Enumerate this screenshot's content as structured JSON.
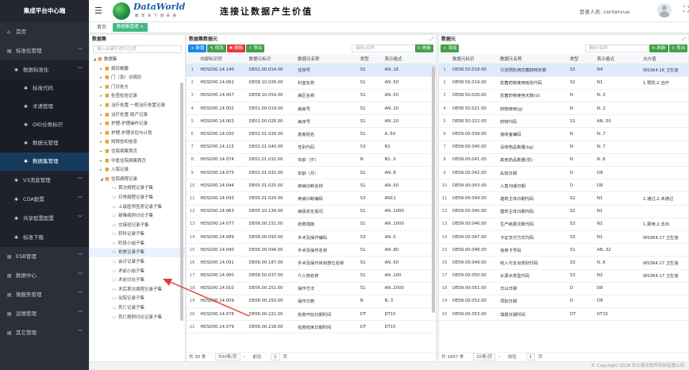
{
  "app": {
    "title": "集成平台中心端"
  },
  "sidebar": [
    {
      "label": "首页",
      "icon": "home-icon",
      "level": 0,
      "arrow": ""
    },
    {
      "label": "标准化管理",
      "icon": "list-icon",
      "level": 0,
      "arrow": "﹀"
    },
    {
      "label": "数据标准化",
      "icon": "gear-icon",
      "level": 1,
      "arrow": "﹀"
    },
    {
      "label": "标准代码",
      "icon": "gear-icon",
      "level": 2,
      "arrow": ""
    },
    {
      "label": "术语管理",
      "icon": "gear-icon",
      "level": 2,
      "arrow": ""
    },
    {
      "label": "OID分类标识",
      "icon": "gear-icon",
      "level": 2,
      "arrow": ""
    },
    {
      "label": "数据元管理",
      "icon": "gear-icon",
      "level": 2,
      "arrow": ""
    },
    {
      "label": "数据集管理",
      "icon": "gear-icon",
      "level": 2,
      "arrow": "",
      "active": true
    },
    {
      "label": "V3消息管理",
      "icon": "gear-icon",
      "level": 1,
      "arrow": "﹀"
    },
    {
      "label": "CDA配置",
      "icon": "gear-icon",
      "level": 1,
      "arrow": "﹀"
    },
    {
      "label": "共享配置配置",
      "icon": "gear-icon",
      "level": 1,
      "arrow": "﹀"
    },
    {
      "label": "标准下载",
      "icon": "gear-icon",
      "level": 1,
      "arrow": ""
    },
    {
      "label": "ESB管理",
      "icon": "list-icon",
      "level": 0,
      "arrow": "﹀"
    },
    {
      "label": "数据中心",
      "icon": "list-icon",
      "level": 0,
      "arrow": "﹀"
    },
    {
      "label": "微服务管理",
      "icon": "list-icon",
      "level": 0,
      "arrow": "﹀"
    },
    {
      "label": "运维管理",
      "icon": "list-icon",
      "level": 0,
      "arrow": "﹀"
    },
    {
      "label": "其它管理",
      "icon": "list-icon",
      "level": 0,
      "arrow": "﹀"
    }
  ],
  "header": {
    "logo_text": "DataWorld",
    "logo_sub": "数 享 天 下 创 未 来",
    "slogan": "连接让数据产生价值",
    "user_label": "登录人员: centervue"
  },
  "tabs": {
    "home": "首页",
    "active": "数据集管理 ×"
  },
  "tree": {
    "title": "数据集",
    "search_placeholder": "输入关键字进行过滤",
    "items": [
      {
        "label": "数据集",
        "depth": 0,
        "type": "folder",
        "tw": "◢"
      },
      {
        "label": "病历概要",
        "depth": 1,
        "type": "folder",
        "tw": "▸"
      },
      {
        "label": "门（急）诊病历",
        "depth": 1,
        "type": "folder",
        "tw": "▸"
      },
      {
        "label": "门诊处方",
        "depth": 1,
        "type": "folder",
        "tw": "▸"
      },
      {
        "label": "检查检验记录",
        "depth": 1,
        "type": "folder",
        "tw": "▸"
      },
      {
        "label": "治疗处置-一般治疗处置记录",
        "depth": 1,
        "type": "folder",
        "tw": "▸"
      },
      {
        "label": "治疗处置-助产记录",
        "depth": 1,
        "type": "folder",
        "tw": "▸"
      },
      {
        "label": "护理-护理操作记录",
        "depth": 1,
        "type": "folder",
        "tw": "▸"
      },
      {
        "label": "护理-护理评估与计划",
        "depth": 1,
        "type": "folder",
        "tw": "▸"
      },
      {
        "label": "知情告知信息",
        "depth": 1,
        "type": "folder",
        "tw": "▸"
      },
      {
        "label": "住院病案首页",
        "depth": 1,
        "type": "folder",
        "tw": "▸"
      },
      {
        "label": "中医住院病案首页",
        "depth": 1,
        "type": "folder",
        "tw": "▸"
      },
      {
        "label": "入院记录",
        "depth": 1,
        "type": "folder",
        "tw": "▸"
      },
      {
        "label": "住院病程记录",
        "depth": 1,
        "type": "folder",
        "tw": "◢"
      },
      {
        "label": "首次病程记录子集",
        "depth": 2,
        "type": "doc",
        "tw": ""
      },
      {
        "label": "日常病程记录子集",
        "depth": 2,
        "type": "doc",
        "tw": ""
      },
      {
        "label": "上级医师查房记录子集",
        "depth": 2,
        "type": "doc",
        "tw": ""
      },
      {
        "label": "疑难病例讨论子集",
        "depth": 2,
        "type": "doc",
        "tw": ""
      },
      {
        "label": "交接班记录子集",
        "depth": 2,
        "type": "doc",
        "tw": ""
      },
      {
        "label": "转科记录子集",
        "depth": 2,
        "type": "doc",
        "tw": ""
      },
      {
        "label": "阶段小结子集",
        "depth": 2,
        "type": "doc",
        "tw": ""
      },
      {
        "label": "抢救记录子集",
        "depth": 2,
        "type": "doc",
        "tw": "",
        "highlight": true
      },
      {
        "label": "会诊记录子集",
        "depth": 2,
        "type": "doc",
        "tw": ""
      },
      {
        "label": "术前小结子集",
        "depth": 2,
        "type": "doc",
        "tw": ""
      },
      {
        "label": "术前讨论子集",
        "depth": 2,
        "type": "doc",
        "tw": ""
      },
      {
        "label": "术后首次病程记录子集",
        "depth": 2,
        "type": "doc",
        "tw": ""
      },
      {
        "label": "出院记录子集",
        "depth": 2,
        "type": "doc",
        "tw": ""
      },
      {
        "label": "死亡记录子集",
        "depth": 2,
        "type": "doc",
        "tw": ""
      },
      {
        "label": "死亡病例讨论记录子集",
        "depth": 2,
        "type": "doc",
        "tw": ""
      }
    ]
  },
  "dataset_panel": {
    "title": "数据集数据元",
    "buttons": [
      {
        "label": "+ 新增",
        "color": "#1e88e5"
      },
      {
        "label": "✎ 修改",
        "color": "#43a047"
      },
      {
        "label": "✖ 删除",
        "color": "#e53935"
      },
      {
        "label": "⇩ 导出",
        "color": "#43a047"
      }
    ],
    "search_placeholder": "编码/名称",
    "refresh": "↻ 刷新",
    "columns": [
      "",
      "内部标识符",
      "数据元标识",
      "数据元名称",
      "类型",
      "表示格式"
    ],
    "rows": [
      [
        "1",
        "HDSD00.14.140",
        "DE01.00.014.00",
        "住院号",
        "S1",
        "AN..18"
      ],
      [
        "2",
        "HDSD00.14.062",
        "DE08.10.026.00",
        "科室名称",
        "S1",
        "AN..50"
      ],
      [
        "3",
        "HDSD00.14.007",
        "DE08.10.054.00",
        "病区名称",
        "S1",
        "AN..50"
      ],
      [
        "4",
        "HDSD00.14.002",
        "DE01.00.019.00",
        "病房号",
        "S1",
        "AN..10"
      ],
      [
        "5",
        "HDSD00.14.003",
        "DE01.00.026.00",
        "病床号",
        "S1",
        "AN..10"
      ],
      [
        "6",
        "HDSD00.14.030",
        "DE02.01.039.00",
        "患者姓名",
        "S1",
        "A..50"
      ],
      [
        "7",
        "HDSD00.14.115",
        "DE02.01.040.00",
        "性别代码",
        "S3",
        "N1"
      ],
      [
        "8",
        "HDSD00.14.074",
        "DE02.01.032.00",
        "年龄（岁）",
        "N",
        "N1..3"
      ],
      [
        "9",
        "HDSD00.14.075",
        "DE02.01.032.00",
        "年龄（月）",
        "S1",
        "AN..8"
      ],
      [
        "10",
        "HDSD00.14.044",
        "DE05.01.025.00",
        "疾病诊断名称",
        "S1",
        "AN..50"
      ],
      [
        "11",
        "HDSD00.14.043",
        "DE05.01.024.00",
        "疾病诊断编码",
        "S3",
        "AN11"
      ],
      [
        "12",
        "HDSD00.14.063",
        "DE05.10.134.00",
        "病情变化情况",
        "S1",
        "AN..1000"
      ],
      [
        "13",
        "HDSD00.14.077",
        "DE06.00.231.00",
        "抢救措施",
        "S1",
        "AN..1000"
      ],
      [
        "14",
        "HDSD00.14.089",
        "DE06.00.093.00",
        "手术及操作编码",
        "S3",
        "AN..5"
      ],
      [
        "15",
        "HDSD00.14.090",
        "DE06.00.094.00",
        "手术及操作名称",
        "S1",
        "AN..80"
      ],
      [
        "16",
        "HDSD00.14.091",
        "DE06.00.187.00",
        "手术及操作目标部位名称",
        "S1",
        "AN..50"
      ],
      [
        "17",
        "HDSD00.14.060",
        "DE08.50.037.00",
        "介入物名称",
        "S1",
        "AN..100"
      ],
      [
        "18",
        "HDSD00.14.010",
        "DE06.00.251.00",
        "操作方法",
        "S1",
        "AN..2000"
      ],
      [
        "19",
        "HDSD00.14.009",
        "DE06.00.250.00",
        "操作次数",
        "N",
        "N..3"
      ],
      [
        "20",
        "HDSD00.14.078",
        "DE06.00.221.00",
        "抢救开始日期时间",
        "DT",
        "DT15"
      ],
      [
        "21",
        "HDSD00.14.079",
        "DE06.00.218.00",
        "抢救结束日期时间",
        "DT",
        "DT15"
      ]
    ],
    "pager": {
      "total": "共 30 条",
      "size": "500条/页",
      "prev": "‹",
      "page_label": "前往",
      "page": "1",
      "suffix": "页"
    }
  },
  "element_panel": {
    "title": "数据元",
    "buttons": [
      {
        "label": "+ 添加",
        "color": "#43a047"
      }
    ],
    "search_placeholder": "编码/名称",
    "actions": [
      {
        "label": "↻ 刷新",
        "color": "#43a047"
      },
      {
        "label": "⇩ 导出",
        "color": "#43a047"
      }
    ],
    "columns": [
      "",
      "数据元标识",
      "数据元名称",
      "类型",
      "表示格式",
      "允许值"
    ],
    "rows": [
      [
        "1",
        "DE08.50.018.00",
        "引流预防用抗菌药物天数",
        "S3",
        "N4",
        "WS364.16 卫生信"
      ],
      [
        "2",
        "DE08.50.019.00",
        "抗菌药物使用级别代码",
        "S2",
        "N1",
        "1.预防;2.治疗"
      ],
      [
        "3",
        "DE08.50.020.00",
        "抗菌药物使用天数(U)",
        "N",
        "N..3",
        ""
      ],
      [
        "4",
        "DE08.50.021.00",
        "药物使用(g)",
        "N",
        "N..2",
        ""
      ],
      [
        "5",
        "DE08.50.022.00",
        "药物代码",
        "S1",
        "AN..50",
        ""
      ],
      [
        "6",
        "DE09.00.039.00",
        "接收者编码",
        "N",
        "N..7",
        ""
      ],
      [
        "7",
        "DE09.00.040.00",
        "设收物品数量(kg)",
        "N",
        "N..7",
        ""
      ],
      [
        "8",
        "DE09.00.041.00",
        "其他药品数量(张)",
        "N",
        "N..6",
        ""
      ],
      [
        "9",
        "DE09.00.042.00",
        "失效日期",
        "D",
        "D8",
        ""
      ],
      [
        "10",
        "DE09.00.043.00",
        "入患沟通日期",
        "D",
        "D8",
        ""
      ],
      [
        "11",
        "DE09.00.044.00",
        "建筑主体日期代码",
        "S2",
        "N1",
        "1.通过;2.未通过"
      ],
      [
        "12",
        "DE09.00.045.00",
        "建筑主体日期代码",
        "S2",
        "N1",
        ""
      ],
      [
        "13",
        "DE09.00.046.00",
        "生产耗费次数代码",
        "S3",
        "N1",
        "1.费用;2.支出"
      ],
      [
        "14",
        "DE09.00.047.00",
        "卡证支付方式代码",
        "S3",
        "N1",
        "WS364.17 卫生信"
      ],
      [
        "15",
        "DE09.00.048.00",
        "信用卡号码",
        "S1",
        "AN..32",
        ""
      ],
      [
        "16",
        "DE09.00.049.00",
        "收入与支出类别代码",
        "S3",
        "N..6",
        "WS364.17 卫生信"
      ],
      [
        "17",
        "DE09.00.050.00",
        "水源水类型代码",
        "S3",
        "N2",
        "WS364.17 卫生信"
      ],
      [
        "18",
        "DE09.00.051.00",
        "日以日期",
        "D",
        "D8",
        ""
      ],
      [
        "19",
        "DE09.00.052.00",
        "项别日期",
        "D",
        "D8",
        ""
      ],
      [
        "20",
        "DE09.00.053.00",
        "填报日期时间",
        "DT",
        "DT15",
        ""
      ]
    ],
    "pager": {
      "total": "共 1667 条",
      "size": "20条/页",
      "prev": "‹",
      "page_label": "前往",
      "page": "1",
      "suffix": "页"
    }
  },
  "footer": {
    "text": "© Copyright 2018 长沙泰沃软件科技有限公司"
  },
  "colors": {
    "accent": "#42b983",
    "sidebar_bg": "#2b2f3a",
    "primary": "#1e88e5",
    "danger": "#e53935",
    "annotation_arrow": "#e53935"
  }
}
